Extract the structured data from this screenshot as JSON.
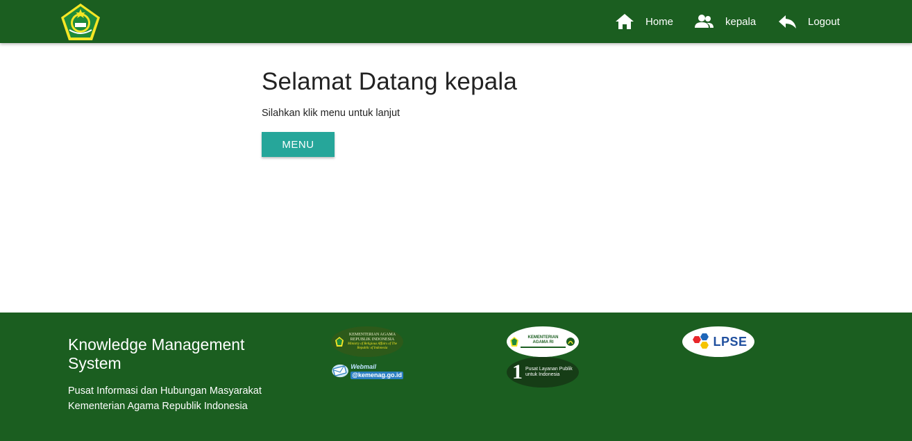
{
  "navbar": {
    "home_label": "Home",
    "user_label": "kepala",
    "logout_label": "Logout"
  },
  "main": {
    "welcome": "Selamat Datang kepala",
    "subtitle": "Silahkan klik menu untuk lanjut",
    "menu_button": "MENU"
  },
  "footer": {
    "title": "Knowledge Management System",
    "line1": "Pusat Informasi dan Hubungan Masyarakat",
    "line2": "Kementerian Agama Republik Indonesia",
    "links": {
      "kemenag_ri": "KEMENTERIAN AGAMA REPUBLIK INDONESIA",
      "kemenag_ri_sub": "Ministry of Religious Affairs of The Republic of Indonesia",
      "kemenag_portal": "KEMENTERIAN AGAMA RI",
      "lpse": "LPSE",
      "webmail": "Webmail",
      "webmail_domain": "@kemenag.go.id",
      "layanan_number": "1",
      "layanan_text": "Pusat Layanan Publik untuk Indonesia"
    }
  },
  "colors": {
    "primary": "#1b5e20",
    "button": "#26a69a"
  }
}
